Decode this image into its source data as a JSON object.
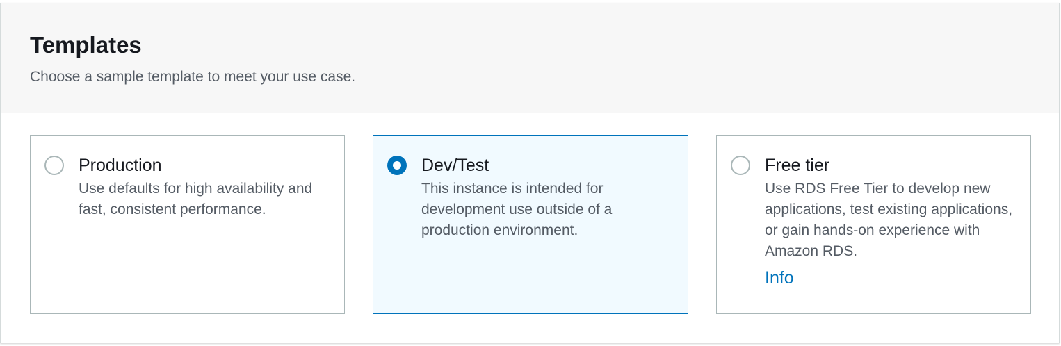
{
  "section": {
    "title": "Templates",
    "description": "Choose a sample template to meet your use case."
  },
  "templates": [
    {
      "label": "Production",
      "description": "Use defaults for high availability and fast, consistent performance.",
      "selected": false
    },
    {
      "label": "Dev/Test",
      "description": "This instance is intended for development use outside of a production environment.",
      "selected": true
    },
    {
      "label": "Free tier",
      "description": "Use RDS Free Tier to develop new applications, test existing applications, or gain hands-on experience with Amazon RDS.",
      "link": "Info",
      "selected": false
    }
  ],
  "colors": {
    "accent": "#0073bb",
    "selected_background": "#f1faff",
    "border": "#aab7b8",
    "header_background": "#f7f7f7"
  }
}
